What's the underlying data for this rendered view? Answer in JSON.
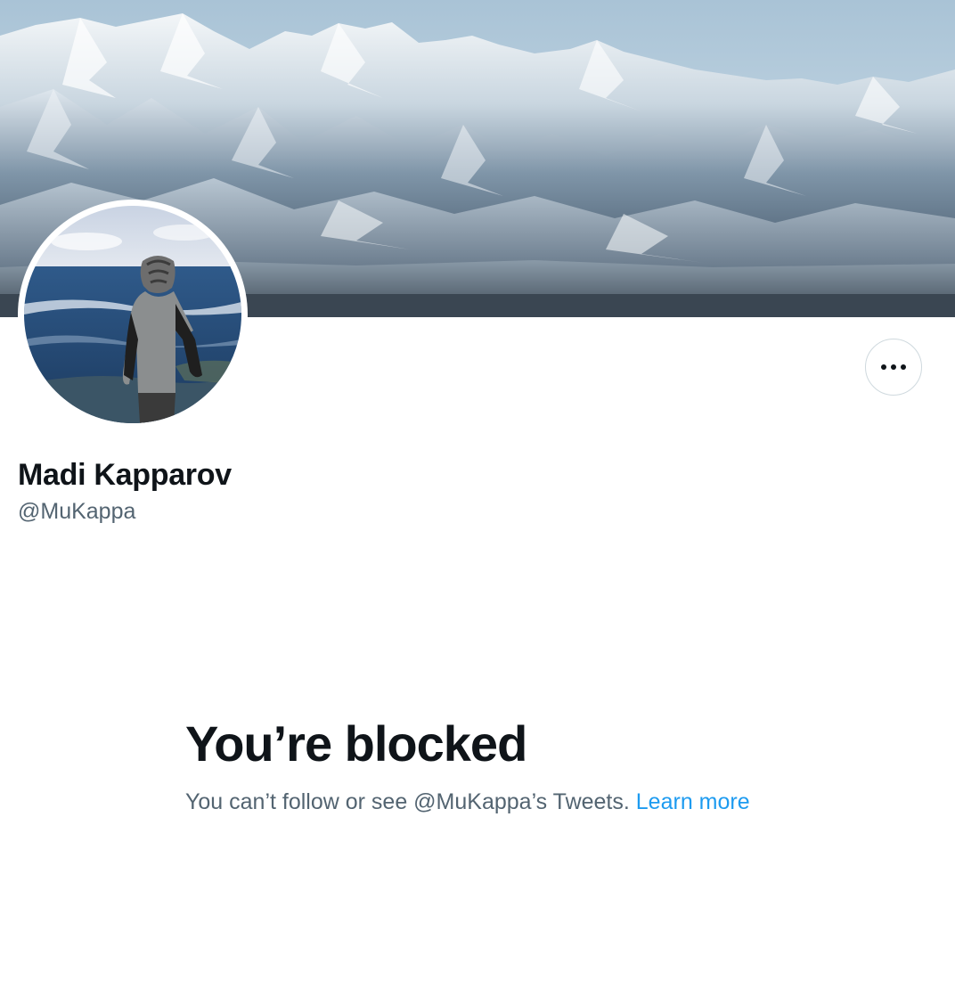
{
  "profile": {
    "display_name": "Madi Kapparov",
    "handle": "@MuKappa"
  },
  "icons": {
    "more": "more-horizontal-icon"
  },
  "blocked": {
    "title": "You’re blocked",
    "message": "You can’t follow or see @MuKappa’s Tweets.",
    "learn_more_label": "Learn more"
  },
  "colors": {
    "primary_text": "#0f1419",
    "secondary_text": "#536471",
    "link": "#1d9bf0",
    "border": "#cfd9de"
  }
}
